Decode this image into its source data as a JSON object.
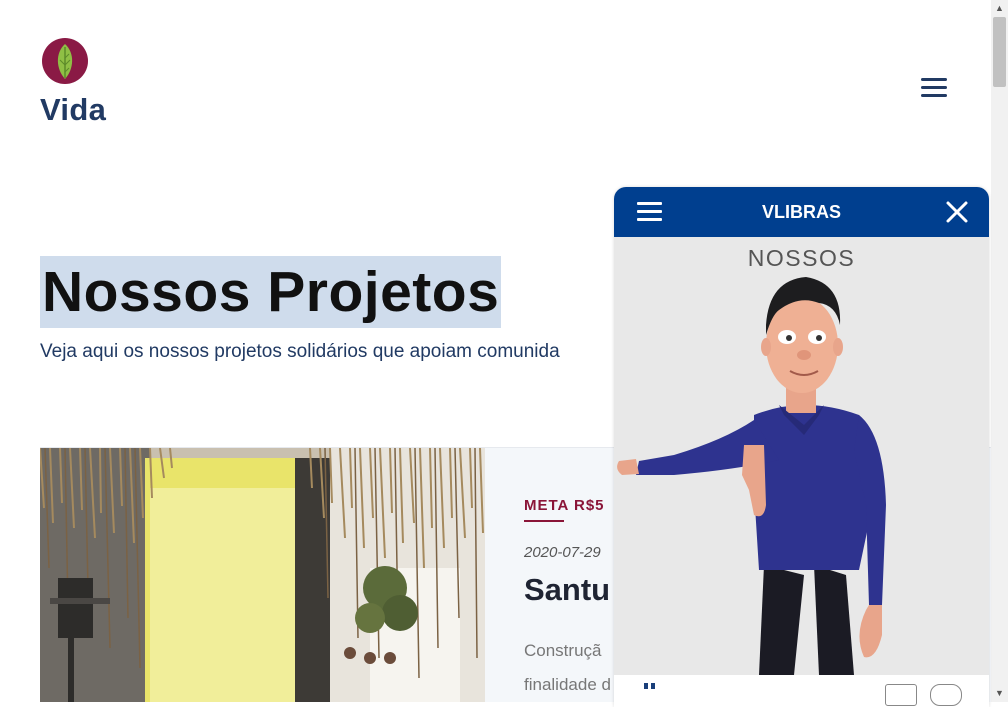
{
  "header": {
    "logo_text": "Vida",
    "logo_icon": "leaf-icon",
    "menu_icon": "hamburger-icon"
  },
  "hero": {
    "title": "Nossos Projetos",
    "subtitle": "Veja aqui os nossos projetos solidários que apoiam comunida"
  },
  "project_card": {
    "meta": "META R$5",
    "date": "2020-07-29",
    "title": "Santu",
    "description_lines": [
      "Construçã",
      "finalidade d"
    ]
  },
  "vlibras": {
    "title": "VLIBRAS",
    "current_word": "NOSSOS",
    "menu_icon": "hamburger-icon",
    "close_icon": "close-icon"
  },
  "colors": {
    "brand_navy": "#213a63",
    "accent_maroon": "#8a1538",
    "vlibras_blue": "#003f8f",
    "highlight": "#cfdcec"
  }
}
